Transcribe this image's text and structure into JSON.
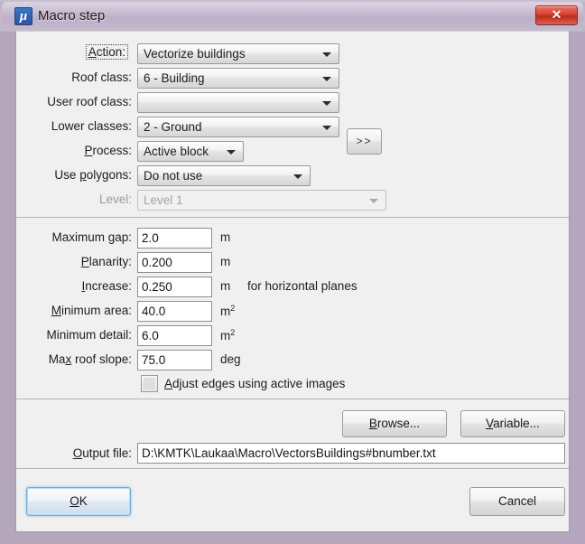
{
  "background_window": {
    "ghost_menu_items": [
      "",
      "",
      "",
      "",
      ""
    ]
  },
  "titlebar": {
    "icon_name": "mu-app-icon",
    "icon_glyph": "μ",
    "title": "Macro step",
    "close_label": "✕"
  },
  "form": {
    "rows": [
      {
        "label_html": "<u>A</u>ction:",
        "value": "Vectorize buildings",
        "type": "combo",
        "focused": true
      },
      {
        "label_html": "Roof class:",
        "value": "6 - Building",
        "type": "combo"
      },
      {
        "label_html": "User roof class:",
        "value": "",
        "type": "combo"
      },
      {
        "label_html": "Lower classes:",
        "value": "2 - Ground",
        "type": "combo"
      },
      {
        "label_html": "<u>P</u>rocess:",
        "value": "Active block",
        "type": "combo"
      },
      {
        "label_html": "Use <u>p</u>olygons:",
        "value": "Do not use",
        "type": "combo"
      },
      {
        "label_html": "Level:",
        "value": "Level 1",
        "type": "combo",
        "disabled": true
      }
    ],
    "expand_button": ">>"
  },
  "params": {
    "rows": [
      {
        "label_html": "Maximum gap:",
        "value": "2.0",
        "unit_html": "m",
        "note": ""
      },
      {
        "label_html": "<u>P</u>lanarity:",
        "value": "0.200",
        "unit_html": "m",
        "note": ""
      },
      {
        "label_html": "<u>I</u>ncrease:",
        "value": "0.250",
        "unit_html": "m",
        "note": "for horizontal planes"
      },
      {
        "label_html": "<u>M</u>inimum area:",
        "value": "40.0",
        "unit_html": "m<sup>2</sup>",
        "note": ""
      },
      {
        "label_html": "Minimum detail:",
        "value": "6.0",
        "unit_html": "m<sup>2</sup>",
        "note": ""
      },
      {
        "label_html": "Ma<u>x</u> roof slope:",
        "value": "75.0",
        "unit_html": "deg",
        "note": ""
      }
    ],
    "checkbox": {
      "label_html": "<u>A</u>djust edges using active images",
      "checked": false
    }
  },
  "output": {
    "browse_label_html": "<u>B</u>rowse...",
    "variable_label_html": "<u>V</u>ariable...",
    "file_label_html": "<u>O</u>utput file:",
    "file_value": "D:\\KMTK\\Laukaa\\Macro\\VectorsBuildings#bnumber.txt"
  },
  "footer": {
    "ok_label_html": "<u>O</u>K",
    "cancel_label_html": "Cancel"
  },
  "colors": {
    "titlebar": "#c2b5cb",
    "close_button": "#d94030",
    "client_bg": "#f0f0f0",
    "default_button_border": "#6faddb"
  }
}
